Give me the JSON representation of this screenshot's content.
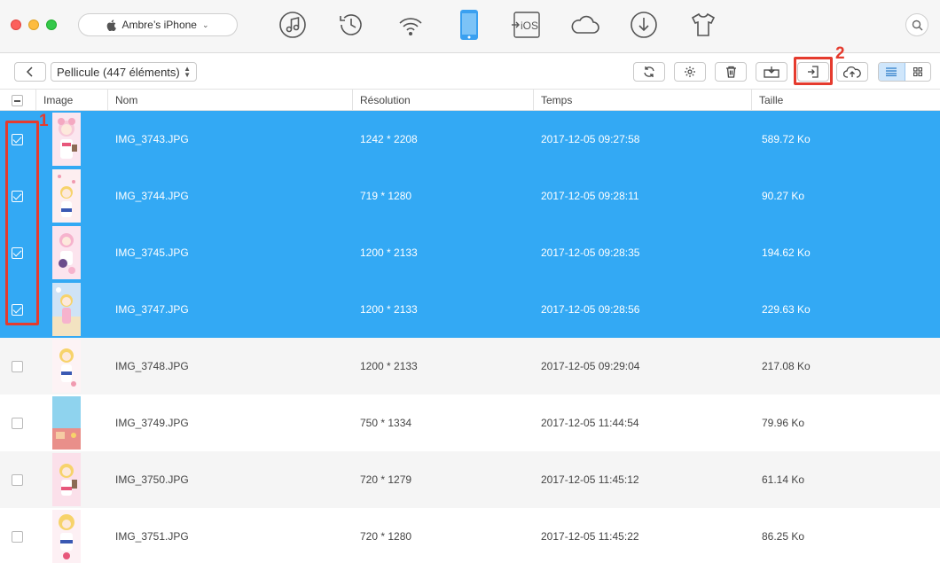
{
  "window": {
    "device_name": "Ambre’s iPhone"
  },
  "top_nav": [
    {
      "icon": "music-icon"
    },
    {
      "icon": "history-icon"
    },
    {
      "icon": "wifi-sync-icon"
    },
    {
      "icon": "iphone-icon",
      "active": true
    },
    {
      "icon": "to-ios-icon",
      "label": "iOS"
    },
    {
      "icon": "cloud-icon"
    },
    {
      "icon": "download-icon"
    },
    {
      "icon": "tshirt-icon"
    }
  ],
  "toolbar": {
    "album": "Pellicule (447 éléments)"
  },
  "callouts": {
    "one": "1",
    "two": "2"
  },
  "table": {
    "columns": {
      "image": "Image",
      "name": "Nom",
      "resolution": "Résolution",
      "time": "Temps",
      "size": "Taille"
    },
    "rows": [
      {
        "name": "IMG_3743.JPG",
        "resolution": "1242 * 2208",
        "time": "2017-12-05 09:27:58",
        "size": "589.72 Ko",
        "selected": true
      },
      {
        "name": "IMG_3744.JPG",
        "resolution": "719 * 1280",
        "time": "2017-12-05 09:28:11",
        "size": "90.27 Ko",
        "selected": true
      },
      {
        "name": "IMG_3745.JPG",
        "resolution": "1200 * 2133",
        "time": "2017-12-05 09:28:35",
        "size": "194.62 Ko",
        "selected": true
      },
      {
        "name": "IMG_3747.JPG",
        "resolution": "1200 * 2133",
        "time": "2017-12-05 09:28:56",
        "size": "229.63 Ko",
        "selected": true
      },
      {
        "name": "IMG_3748.JPG",
        "resolution": "1200 * 2133",
        "time": "2017-12-05 09:29:04",
        "size": "217.08 Ko",
        "selected": false
      },
      {
        "name": "IMG_3749.JPG",
        "resolution": "750 * 1334",
        "time": "2017-12-05 11:44:54",
        "size": "79.96 Ko",
        "selected": false
      },
      {
        "name": "IMG_3750.JPG",
        "resolution": "720 * 1279",
        "time": "2017-12-05 11:45:12",
        "size": "61.14 Ko",
        "selected": false
      },
      {
        "name": "IMG_3751.JPG",
        "resolution": "720 * 1280",
        "time": "2017-12-05 11:45:22",
        "size": "86.25 Ko",
        "selected": false
      }
    ]
  },
  "colors": {
    "selection": "#33a9f4",
    "callout": "#e53b2e",
    "active_device": "#3aa0f0"
  }
}
